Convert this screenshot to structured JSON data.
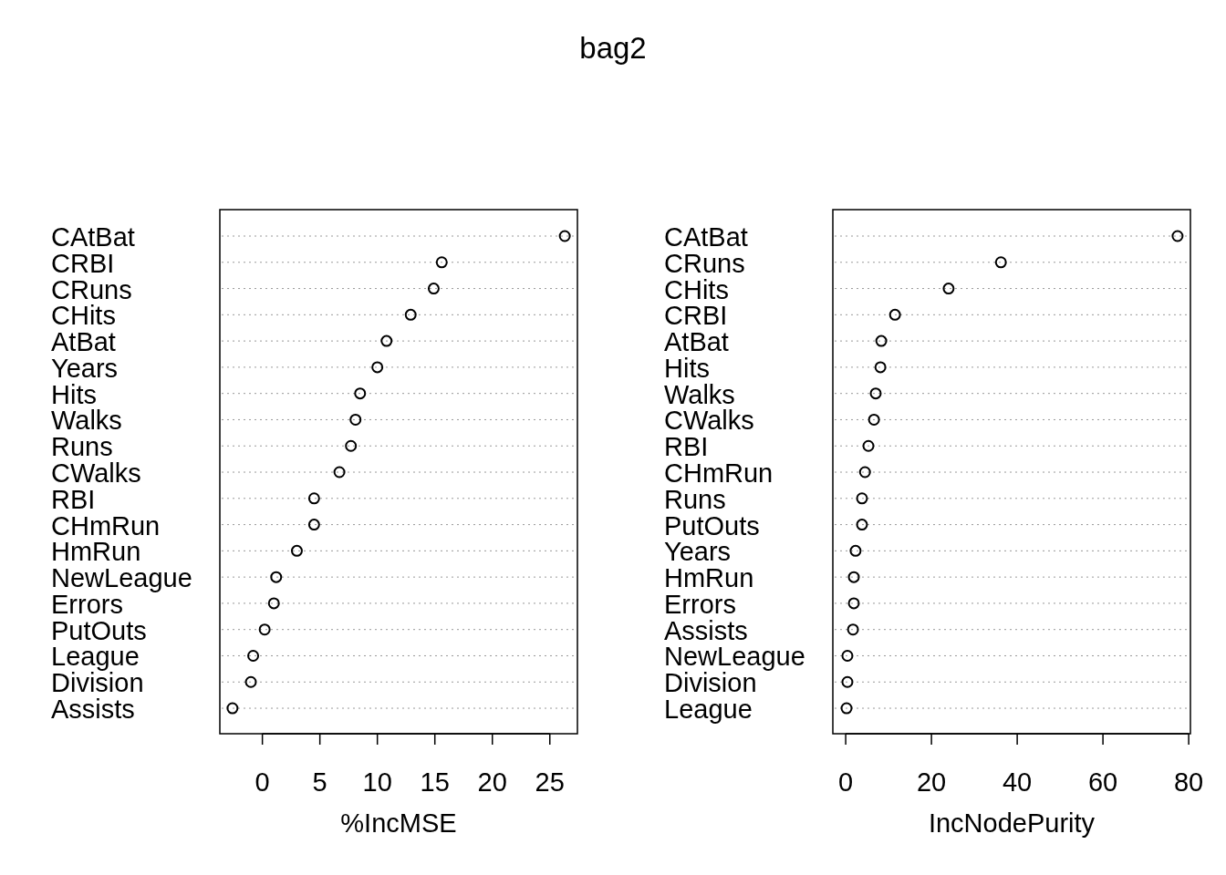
{
  "title": "bag2",
  "panels": [
    {
      "chart_data": {
        "type": "scatter",
        "orientation": "horizontal",
        "xlabel": "%IncMSE",
        "categories": [
          "CAtBat",
          "CRBI",
          "CRuns",
          "CHits",
          "AtBat",
          "Years",
          "Hits",
          "Walks",
          "Runs",
          "CWalks",
          "RBI",
          "CHmRun",
          "HmRun",
          "NewLeague",
          "Errors",
          "PutOuts",
          "League",
          "Division",
          "Assists"
        ],
        "grid": true,
        "series": [
          {
            "color": "#000000",
            "values": [
              26.3,
              15.6,
              14.9,
              12.9,
              10.8,
              10.0,
              8.5,
              8.1,
              7.7,
              6.7,
              4.5,
              4.5,
              3.0,
              1.2,
              1.0,
              0.2,
              -0.8,
              -1.0,
              -2.6
            ]
          }
        ],
        "xlim": [
          -3.7,
          27.4
        ],
        "xticks": [
          0,
          5,
          10,
          15,
          20,
          25
        ]
      }
    },
    {
      "chart_data": {
        "type": "scatter",
        "orientation": "horizontal",
        "xlabel": "IncNodePurity",
        "categories": [
          "CAtBat",
          "CRuns",
          "CHits",
          "CRBI",
          "AtBat",
          "Hits",
          "Walks",
          "CWalks",
          "RBI",
          "CHmRun",
          "Runs",
          "PutOuts",
          "Years",
          "HmRun",
          "Errors",
          "Assists",
          "NewLeague",
          "Division",
          "League"
        ],
        "grid": true,
        "series": [
          {
            "color": "#000000",
            "values": [
              77.4,
              36.2,
              24.0,
              11.5,
              8.3,
              8.1,
              7.0,
              6.6,
              5.3,
              4.5,
              3.8,
              3.8,
              2.3,
              1.9,
              1.9,
              1.7,
              0.4,
              0.4,
              0.2
            ]
          }
        ],
        "xlim": [
          -3.0,
          80.4
        ],
        "xticks": [
          0,
          20,
          40,
          60,
          80
        ]
      }
    }
  ]
}
